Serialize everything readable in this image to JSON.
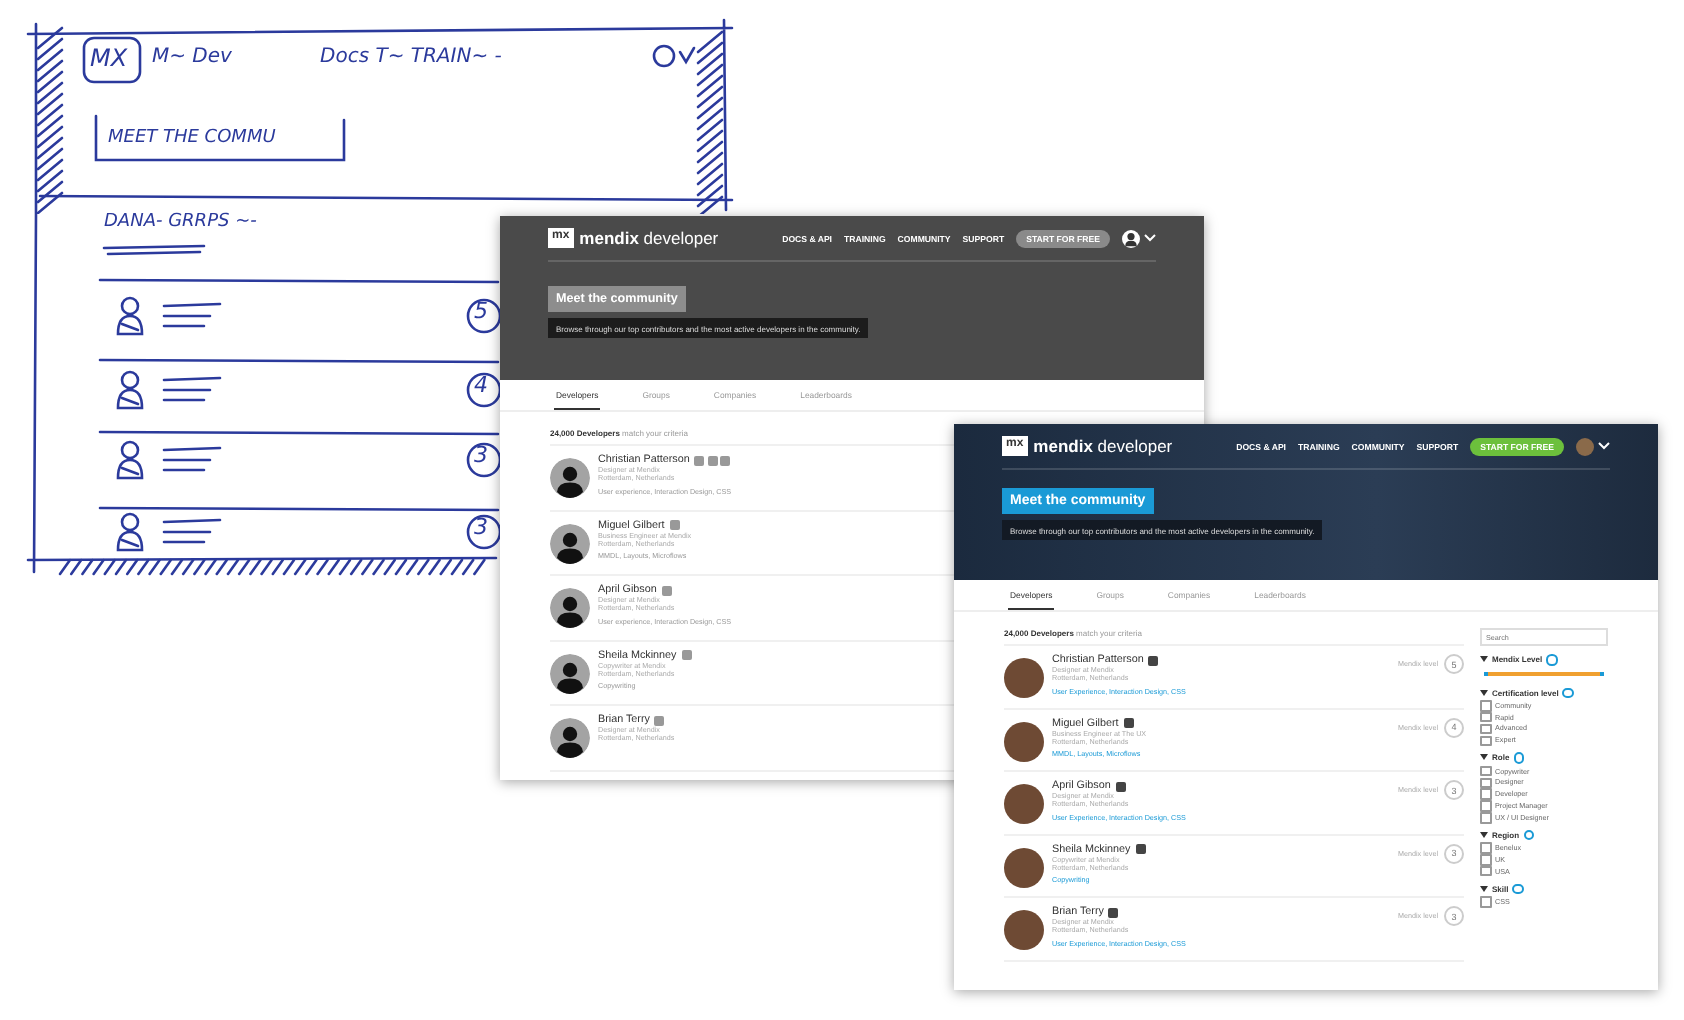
{
  "sketch": {
    "logo": "MX",
    "nav": [
      "M~ Dev",
      "Docs T~ TRAIN~ -"
    ],
    "title": "MEET THE COMMU",
    "tabs": "DANA- GRRPS ~-",
    "rows": [
      {
        "score": "5"
      },
      {
        "score": "4"
      },
      {
        "score": "3"
      },
      {
        "score": "3"
      }
    ]
  },
  "screens": [
    {
      "kind": "wireframe",
      "logo": {
        "mark": "mx",
        "text": "**mendix** developer"
      },
      "nav": [
        "DOCS & API",
        "TRAINING",
        "COMMUNITY",
        "SUPPORT"
      ],
      "cta": "START FOR FREE",
      "title": "Meet the community",
      "subtitle": "Browse through our top contributors and the most active developers in the community.",
      "tabs": [
        {
          "label": "Developers",
          "selected": true
        },
        {
          "label": "Groups",
          "selected": false
        },
        {
          "label": "Companies",
          "selected": false
        },
        {
          "label": "Leaderboards",
          "selected": false
        }
      ],
      "count": "**24,000 Developers** match your criteria",
      "rows": [
        {
          "name": "Christian Patterson",
          "badges": [
            {
              "kind": "certificate"
            },
            {
              "kind": "certificate"
            },
            {
              "kind": "certificate"
            }
          ],
          "role": "Designer at Mendix",
          "location": "Rotterdam, Netherlands",
          "skills": "User experience, Interaction Design, CSS"
        },
        {
          "name": "Miguel Gilbert",
          "badges": [
            {
              "kind": "certificate"
            }
          ],
          "role": "Business Engineer at Mendix",
          "location": "Rotterdam, Netherlands",
          "skills": "MMDL, Layouts, Microflows"
        },
        {
          "name": "April Gibson",
          "badges": [
            {
              "kind": "certificate"
            }
          ],
          "role": "Designer at Mendix",
          "location": "Rotterdam, Netherlands",
          "skills": "User experience, Interaction Design, CSS"
        },
        {
          "name": "Sheila Mckinney",
          "badges": [
            {
              "kind": "certificate"
            }
          ],
          "role": "Copywriter at Mendix",
          "location": "Rotterdam, Netherlands",
          "skills": "Copywriting"
        },
        {
          "name": "Brian Terry",
          "badges": [
            {
              "kind": "certificate"
            }
          ],
          "role": "Designer at Mendix",
          "location": "Rotterdam, Netherlands"
        }
      ]
    },
    {
      "kind": "final",
      "logo": {
        "mark": "mx",
        "text": "**mendix** developer"
      },
      "nav": [
        "DOCS & API",
        "TRAINING",
        "COMMUNITY",
        "SUPPORT"
      ],
      "cta": "START FOR FREE",
      "title": "Meet the community",
      "subtitle": "Browse through our top contributors and the most active developers in the community.",
      "tabs": [
        {
          "label": "Developers",
          "selected": true
        },
        {
          "label": "Groups",
          "selected": false
        },
        {
          "label": "Companies",
          "selected": false
        },
        {
          "label": "Leaderboards",
          "selected": false
        }
      ],
      "count": "**24,000 Developers** match your criteria",
      "rows": [
        {
          "name": "Christian Patterson",
          "badges": [
            {
              "kind": "certificate"
            }
          ],
          "role": "Designer at Mendix",
          "location": "Rotterdam, Netherlands",
          "skills": "User Experience, Interaction Design, CSS",
          "score_label": "Mendix level",
          "score": "5"
        },
        {
          "name": "Miguel Gilbert",
          "badges": [
            {
              "kind": "certificate"
            }
          ],
          "role": "Business Engineer at The UX",
          "location": "Rotterdam, Netherlands",
          "skills": "MMDL, Layouts, Microflows",
          "score_label": "Mendix level",
          "score": "4"
        },
        {
          "name": "April Gibson",
          "badges": [
            {
              "kind": "certificate"
            }
          ],
          "role": "Designer at Mendix",
          "location": "Rotterdam, Netherlands",
          "skills": "User Experience, Interaction Design, CSS",
          "score_label": "Mendix level",
          "score": "3"
        },
        {
          "name": "Sheila Mckinney",
          "badges": [
            {
              "kind": "certificate"
            }
          ],
          "role": "Copywriter at Mendix",
          "location": "Rotterdam, Netherlands",
          "skills": "Copywriting",
          "score_label": "Mendix level",
          "score": "3"
        },
        {
          "name": "Brian Terry",
          "badges": [
            {
              "kind": "certificate"
            }
          ],
          "role": "Designer at Mendix",
          "location": "Rotterdam, Netherlands",
          "skills": "User Experience, Interaction Design, CSS",
          "score_label": "Mendix level",
          "score": "3"
        }
      ],
      "sidebar": {
        "search": {
          "placeholder": "Search"
        },
        "filters": [
          {
            "kind": "slider",
            "title": "Mendix Level",
            "level": 1
          },
          {
            "kind": "checkboxes",
            "title": "Certification level",
            "options": [
              {
                "label": "Community",
                "checked": false
              },
              {
                "label": "Rapid",
                "checked": false
              },
              {
                "label": "Advanced",
                "checked": false
              },
              {
                "label": "Expert",
                "checked": false
              }
            ]
          },
          {
            "kind": "checkboxes",
            "title": "Role",
            "options": [
              {
                "label": "Copywriter",
                "checked": false
              },
              {
                "label": "Designer",
                "checked": false
              },
              {
                "label": "Developer",
                "checked": false
              },
              {
                "label": "Project Manager",
                "checked": false
              },
              {
                "label": "UX / UI Designer",
                "checked": false
              }
            ]
          },
          {
            "kind": "checkboxes",
            "title": "Region",
            "options": [
              {
                "label": "Benelux",
                "checked": false
              },
              {
                "label": "UK",
                "checked": false
              },
              {
                "label": "USA",
                "checked": false
              }
            ]
          },
          {
            "kind": "checkboxes",
            "title": "Skill",
            "options": [
              {
                "label": "CSS",
                "checked": false
              }
            ]
          }
        ]
      }
    }
  ]
}
